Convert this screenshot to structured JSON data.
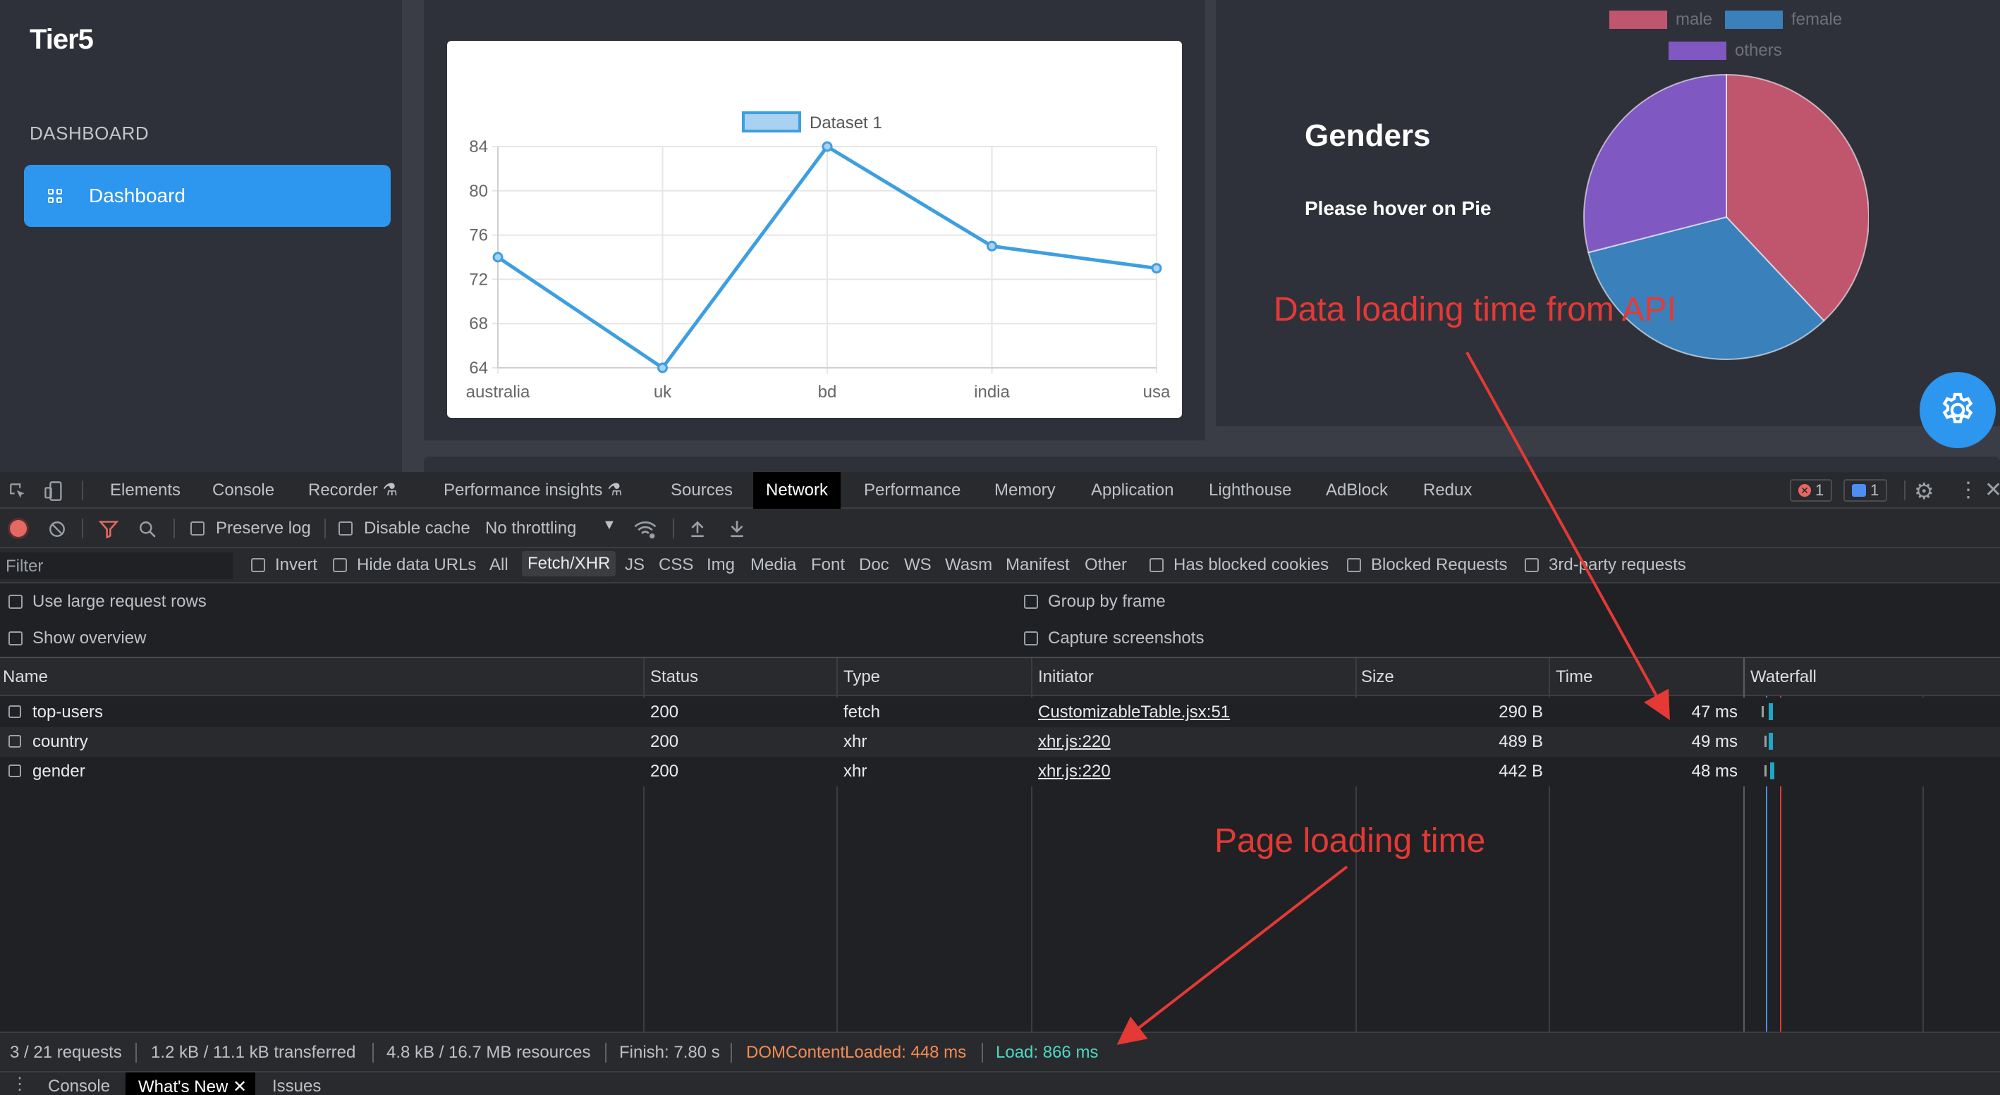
{
  "app": {
    "brand": "Tier5",
    "nav_heading": "DASHBOARD",
    "nav_items": [
      {
        "label": "Dashboard",
        "icon": "grid-icon",
        "active": true
      }
    ],
    "genders_title": "Genders",
    "genders_hint": "Please hover on Pie",
    "settings_icon": "gear-icon",
    "accent_color": "#2d96ee"
  },
  "chart_data": [
    {
      "type": "line",
      "categories": [
        "australia",
        "uk",
        "bd",
        "india",
        "usa"
      ],
      "series": [
        {
          "name": "Dataset 1",
          "values": [
            74,
            64,
            84,
            75,
            73
          ],
          "color": "#3e9fe0"
        }
      ],
      "yticks": [
        "84",
        "80",
        "76",
        "72",
        "68",
        "64"
      ],
      "ylim": [
        64,
        84
      ],
      "grid": true,
      "legend_position": "top"
    },
    {
      "type": "pie",
      "labels": [
        "male",
        "female",
        "others"
      ],
      "values": [
        38,
        33,
        29
      ],
      "colors": [
        "#c0566e",
        "#3a81bc",
        "#7f58c2"
      ],
      "legend_position": "top"
    }
  ],
  "annotations": {
    "api_time": "Data loading time from API",
    "page_time": "Page loading time"
  },
  "devtools": {
    "tabs": [
      "Elements",
      "Console",
      "Recorder",
      "Performance insights",
      "Sources",
      "Network",
      "Performance",
      "Memory",
      "Application",
      "Lighthouse",
      "AdBlock",
      "Redux"
    ],
    "active_tab": "Network",
    "error_count": "1",
    "message_count": "1",
    "toolbar": {
      "preserve_log": "Preserve log",
      "disable_cache": "Disable cache",
      "throttling": "No throttling"
    },
    "filter": {
      "placeholder": "Filter",
      "invert": "Invert",
      "hide_data_urls": "Hide data URLs",
      "types": [
        "All",
        "Fetch/XHR",
        "JS",
        "CSS",
        "Img",
        "Media",
        "Font",
        "Doc",
        "WS",
        "Wasm",
        "Manifest",
        "Other"
      ],
      "active_type": "Fetch/XHR",
      "has_blocked_cookies": "Has blocked cookies",
      "blocked_requests": "Blocked Requests",
      "third_party": "3rd-party requests"
    },
    "options": {
      "large_rows": "Use large request rows",
      "show_overview": "Show overview",
      "group_by_frame": "Group by frame",
      "capture_screenshots": "Capture screenshots"
    },
    "columns": [
      "Name",
      "Status",
      "Type",
      "Initiator",
      "Size",
      "Time",
      "Waterfall"
    ],
    "rows": [
      {
        "name": "top-users",
        "status": "200",
        "type": "fetch",
        "initiator": "CustomizableTable.jsx:51",
        "size": "290 B",
        "time": "47 ms"
      },
      {
        "name": "country",
        "status": "200",
        "type": "xhr",
        "initiator": "xhr.js:220",
        "size": "489 B",
        "time": "49 ms"
      },
      {
        "name": "gender",
        "status": "200",
        "type": "xhr",
        "initiator": "xhr.js:220",
        "size": "442 B",
        "time": "48 ms"
      }
    ],
    "summary": {
      "requests": "3 / 21 requests",
      "transferred": "1.2 kB / 11.1 kB transferred",
      "resources": "4.8 kB / 16.7 MB resources",
      "finish": "Finish: 7.80 s",
      "dom_content_loaded": "DOMContentLoaded: 448 ms",
      "load": "Load: 866 ms"
    },
    "drawer_tabs": [
      "Console",
      "What's New",
      "Issues"
    ],
    "drawer_active": "What's New"
  }
}
